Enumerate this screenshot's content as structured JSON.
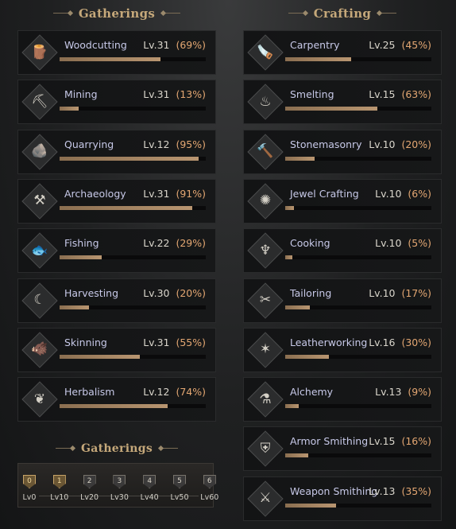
{
  "gatherings": {
    "title": "Gatherings",
    "skills": [
      {
        "name": "Woodcutting",
        "level": "Lv.31",
        "percent": "(69%)",
        "progress": 69,
        "icon": "log-icon",
        "glyph": "🪵"
      },
      {
        "name": "Mining",
        "level": "Lv.31",
        "percent": "(13%)",
        "progress": 13,
        "icon": "pickaxe-icon",
        "glyph": "⛏"
      },
      {
        "name": "Quarrying",
        "level": "Lv.12",
        "percent": "(95%)",
        "progress": 95,
        "icon": "stone-icon",
        "glyph": "🪨"
      },
      {
        "name": "Archaeology",
        "level": "Lv.31",
        "percent": "(91%)",
        "progress": 91,
        "icon": "shovel-icon",
        "glyph": "⚒"
      },
      {
        "name": "Fishing",
        "level": "Lv.22",
        "percent": "(29%)",
        "progress": 29,
        "icon": "fish-icon",
        "glyph": "🐟"
      },
      {
        "name": "Harvesting",
        "level": "Lv.30",
        "percent": "(20%)",
        "progress": 20,
        "icon": "sickle-icon",
        "glyph": "☾"
      },
      {
        "name": "Skinning",
        "level": "Lv.31",
        "percent": "(55%)",
        "progress": 55,
        "icon": "boar-icon",
        "glyph": "🐗"
      },
      {
        "name": "Herbalism",
        "level": "Lv.12",
        "percent": "(74%)",
        "progress": 74,
        "icon": "leaf-icon",
        "glyph": "❦"
      }
    ]
  },
  "crafting": {
    "title": "Crafting",
    "skills": [
      {
        "name": "Carpentry",
        "level": "Lv.25",
        "percent": "(45%)",
        "progress": 45,
        "icon": "saw-icon",
        "glyph": "🪚"
      },
      {
        "name": "Smelting",
        "level": "Lv.15",
        "percent": "(63%)",
        "progress": 63,
        "icon": "furnace-icon",
        "glyph": "♨"
      },
      {
        "name": "Stonemasonry",
        "level": "Lv.10",
        "percent": "(20%)",
        "progress": 20,
        "icon": "chisel-hammer-icon",
        "glyph": "🔨"
      },
      {
        "name": "Jewel Crafting",
        "level": "Lv.10",
        "percent": "(6%)",
        "progress": 6,
        "icon": "gem-icon",
        "glyph": "✺"
      },
      {
        "name": "Cooking",
        "level": "Lv.10",
        "percent": "(5%)",
        "progress": 5,
        "icon": "cauldron-icon",
        "glyph": "♆"
      },
      {
        "name": "Tailoring",
        "level": "Lv.10",
        "percent": "(17%)",
        "progress": 17,
        "icon": "needle-thread-icon",
        "glyph": "✂"
      },
      {
        "name": "Leatherworking",
        "level": "Lv.16",
        "percent": "(30%)",
        "progress": 30,
        "icon": "hide-icon",
        "glyph": "✶"
      },
      {
        "name": "Alchemy",
        "level": "Lv.13",
        "percent": "(9%)",
        "progress": 9,
        "icon": "mortar-icon",
        "glyph": "⚗"
      },
      {
        "name": "Armor Smithing",
        "level": "Lv.15",
        "percent": "(16%)",
        "progress": 16,
        "icon": "armor-icon",
        "glyph": "⛨"
      },
      {
        "name": "Weapon Smithing",
        "level": "Lv.13",
        "percent": "(35%)",
        "progress": 35,
        "icon": "sword-icon",
        "glyph": "⚔"
      }
    ]
  },
  "tier_panel": {
    "title": "Gatherings",
    "tiers": [
      {
        "label": "Lv0",
        "rank": "0",
        "active": true
      },
      {
        "label": "Lv10",
        "rank": "1",
        "active": true
      },
      {
        "label": "Lv20",
        "rank": "2",
        "active": false
      },
      {
        "label": "Lv30",
        "rank": "3",
        "active": false
      },
      {
        "label": "Lv40",
        "rank": "4",
        "active": false
      },
      {
        "label": "Lv50",
        "rank": "5",
        "active": false
      },
      {
        "label": "Lv60",
        "rank": "6",
        "active": false
      }
    ]
  },
  "colors": {
    "accent_title": "#c5a87a",
    "skill_name": "#c7c9e8",
    "percent": "#e3a772",
    "bar_fill": "#b99671"
  }
}
